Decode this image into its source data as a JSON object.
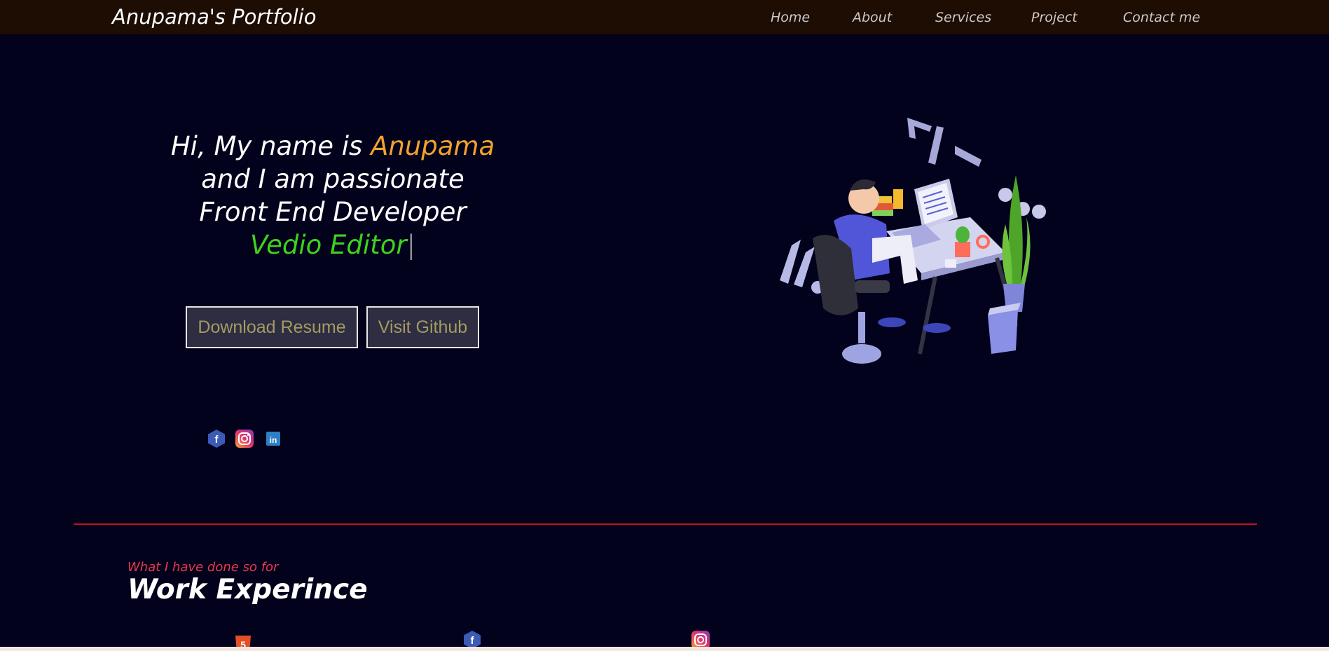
{
  "navbar": {
    "brand": "Anupama's Portfolio",
    "links": [
      "Home",
      "About",
      "Services",
      "Project",
      "Contact me"
    ]
  },
  "hero": {
    "greeting": "Hi, My name is ",
    "name": "Anupama",
    "line2": "and I am passionate",
    "line3": "Front End Developer",
    "typed_role": "Vedio Editor",
    "cursor": "|",
    "buttons": {
      "download": "Download Resume",
      "github": "Visit Github"
    },
    "social_icons": [
      "facebook-icon",
      "instagram-icon",
      "linkedin-icon"
    ],
    "illustration": "developer-at-desk-illustration"
  },
  "work": {
    "subtitle": "What I have done so for",
    "title": "Work Experince",
    "icons": [
      "html5-icon",
      "facebook-icon",
      "instagram-icon"
    ]
  },
  "colors": {
    "background": "#02021c",
    "navbar": "#1d0d03",
    "name_accent": "#f2a22b",
    "role_accent": "#3fd11f",
    "divider": "#c4121a",
    "subtitle": "#e8394d"
  }
}
